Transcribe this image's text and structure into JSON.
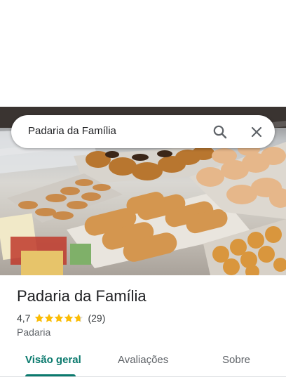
{
  "search": {
    "query": "Padaria da Família"
  },
  "place": {
    "name": "Padaria da Família",
    "rating": "4,7",
    "rating_value": 4.7,
    "review_count": "(29)",
    "category": "Padaria"
  },
  "tabs": [
    {
      "label": "Visão geral",
      "active": true
    },
    {
      "label": "Avaliações",
      "active": false
    },
    {
      "label": "Sobre",
      "active": false
    }
  ],
  "colors": {
    "accent": "#0b7a6e",
    "star": "#fbbc04"
  },
  "icons": {
    "search": "search-icon",
    "close": "close-icon",
    "star": "star-icon"
  }
}
